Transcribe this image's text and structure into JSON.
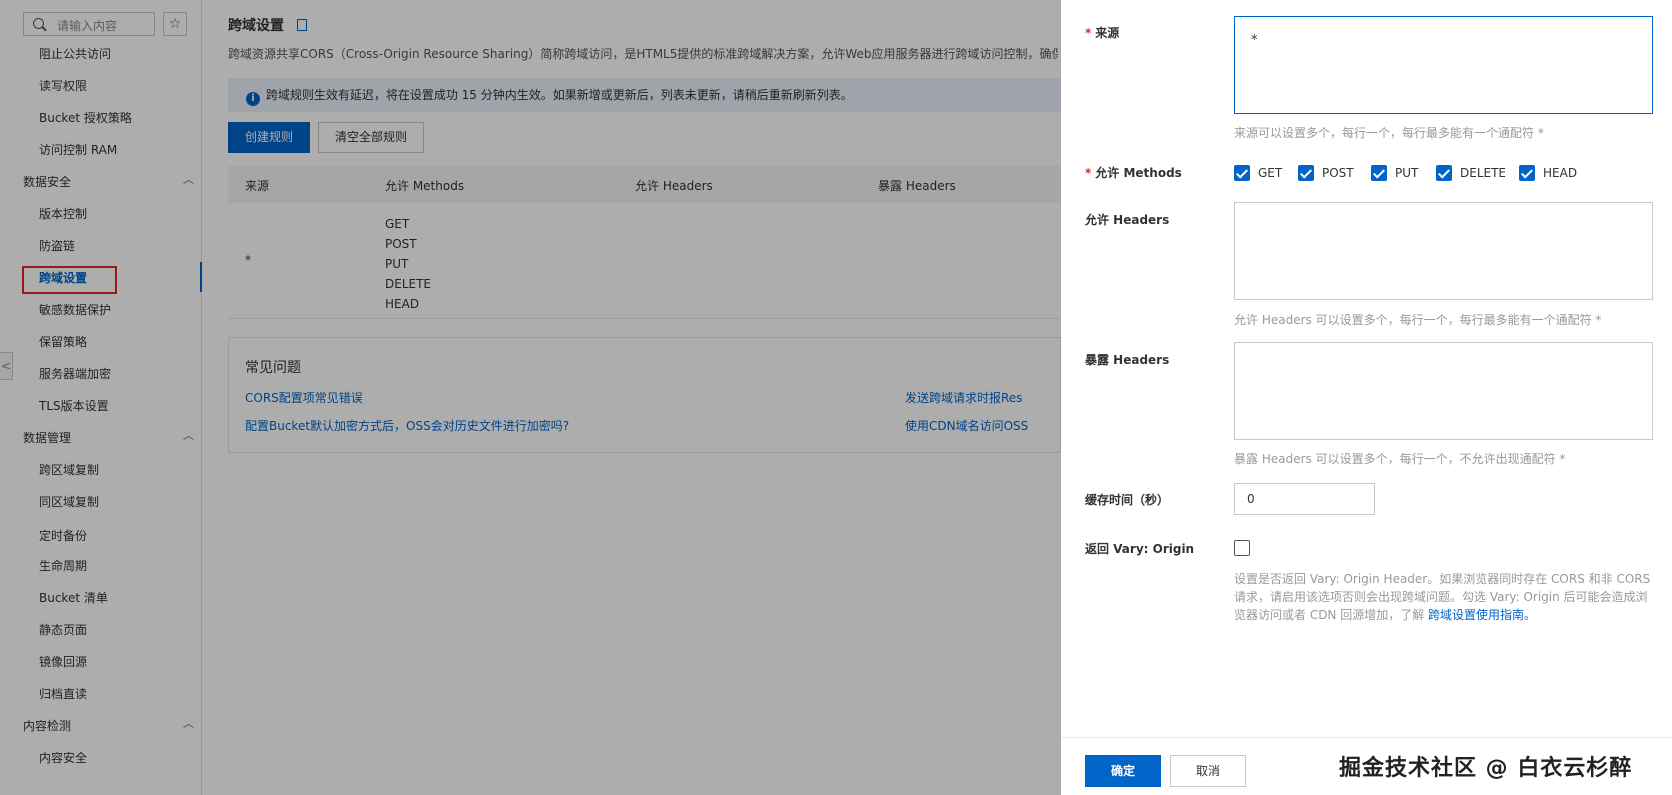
{
  "sidebar": {
    "search_placeholder": "请输入内容",
    "star_glyph": "☆",
    "items": [
      {
        "label": "阻止公共访问"
      },
      {
        "label": "读写权限"
      },
      {
        "label": "Bucket 授权策略"
      },
      {
        "label": "访问控制 RAM"
      },
      {
        "label": "数据安全"
      },
      {
        "label": "版本控制"
      },
      {
        "label": "防盗链"
      },
      {
        "label": "跨域设置"
      },
      {
        "label": "敏感数据保护"
      },
      {
        "label": "保留策略"
      },
      {
        "label": "服务器端加密"
      },
      {
        "label": "TLS版本设置"
      },
      {
        "label": "数据管理"
      },
      {
        "label": "跨区域复制"
      },
      {
        "label": "同区域复制"
      },
      {
        "label": "定时备份"
      },
      {
        "label": "生命周期"
      },
      {
        "label": "Bucket 清单"
      },
      {
        "label": "静态页面"
      },
      {
        "label": "镜像回源"
      },
      {
        "label": "归档直读"
      },
      {
        "label": "内容检测"
      },
      {
        "label": "内容安全"
      }
    ],
    "chevron": "︿",
    "collapse_glyph": "<"
  },
  "main": {
    "title": "跨域设置",
    "description": "跨域资源共享CORS（Cross-Origin Resource Sharing）简称跨域访问，是HTML5提供的标准跨域解决方案，允许Web应用服务器进行跨域访问控制，确保跨域数",
    "notice": "跨域规则生效有延迟，将在设置成功 15 分钟内生效。如果新增或更新后，列表未更新，请稍后重新刷新列表。",
    "notice_icon_glyph": "i",
    "create_button": "创建规则",
    "clear_button": "清空全部规则",
    "table": {
      "headers": [
        "来源",
        "允许 Methods",
        "允许 Headers",
        "暴露 Headers"
      ],
      "row": {
        "origin": "*",
        "methods": [
          "GET",
          "POST",
          "PUT",
          "DELETE",
          "HEAD"
        ]
      }
    },
    "faq": {
      "title": "常见问题",
      "links": [
        "CORS配置项常见错误",
        "发送跨域请求时报Res",
        "配置Bucket默认加密方式后，OSS会对历史文件进行加密吗?",
        "使用CDN域名访问OSS"
      ]
    }
  },
  "drawer": {
    "origin": {
      "label": "来源",
      "value": "*",
      "hint": "来源可以设置多个，每行一个，每行最多能有一个通配符 *"
    },
    "methods": {
      "label": "允许 Methods",
      "options": [
        "GET",
        "POST",
        "PUT",
        "DELETE",
        "HEAD"
      ],
      "checked": [
        true,
        true,
        true,
        true,
        true
      ]
    },
    "allow_headers": {
      "label": "允许 Headers",
      "value": "",
      "hint": "允许 Headers 可以设置多个，每行一个，每行最多能有一个通配符 *"
    },
    "expose_headers": {
      "label": "暴露 Headers",
      "value": "",
      "hint": "暴露 Headers 可以设置多个，每行一个，不允许出现通配符 *"
    },
    "cache": {
      "label": "缓存时间（秒）",
      "value": "0"
    },
    "vary": {
      "label": "返回 Vary: Origin",
      "checked": false,
      "hint": "设置是否返回 Vary: Origin Header。如果浏览器同时存在 CORS 和非 CORS 请求，请启用该选项否则会出现跨域问题。勾选 Vary: Origin 后可能会造成浏览器访问或者 CDN 回源增加，了解 ",
      "hint_link": "跨域设置使用指南。"
    },
    "required_mark": "*",
    "ok_button": "确定",
    "cancel_button": "取消",
    "watermark": "掘金技术社区 @ 白衣云杉醉"
  },
  "colors": {
    "accent": "#0064c8",
    "required": "#e3262b",
    "highlight_box": "#e3262b"
  }
}
